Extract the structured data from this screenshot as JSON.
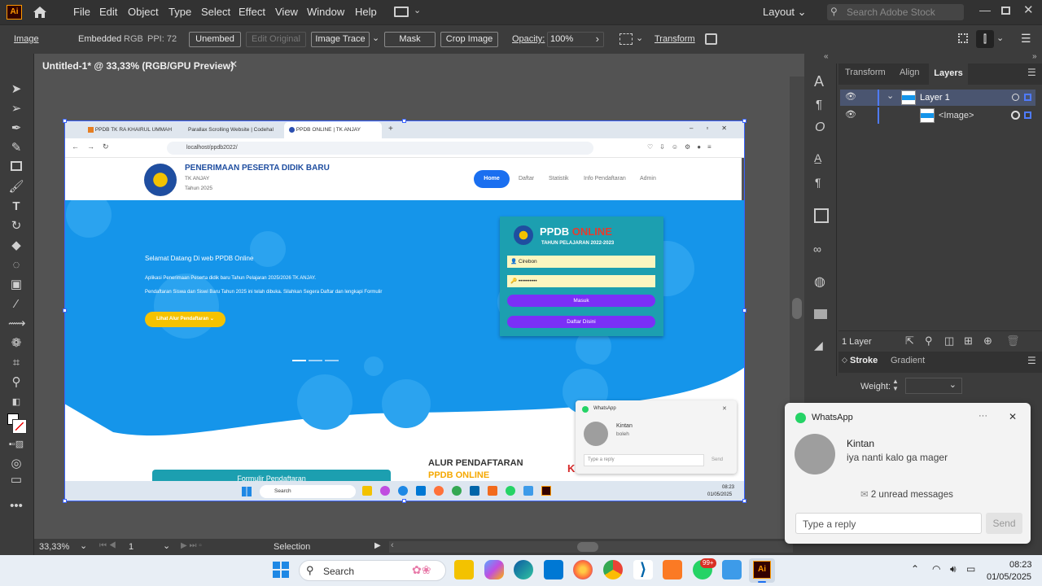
{
  "app": {
    "logo": "Ai",
    "menu": [
      "File",
      "Edit",
      "Object",
      "Type",
      "Select",
      "Effect",
      "View",
      "Window",
      "Help"
    ],
    "workspace": "Layout",
    "search_placeholder": "Search Adobe Stock"
  },
  "control_bar": {
    "object_type": "Image",
    "embedded": "Embedded",
    "color_mode": "RGB",
    "ppi": "PPI: 72",
    "unembed": "Unembed",
    "edit_original": "Edit Original",
    "image_trace": "Image Trace",
    "mask": "Mask",
    "crop_image": "Crop Image",
    "opacity_label": "Opacity:",
    "opacity_value": "100%",
    "transform": "Transform"
  },
  "document": {
    "tab_title": "Untitled-1* @ 33,33% (RGB/GPU Preview)",
    "zoom": "33,33%",
    "artboard_num": "1",
    "status_tool": "Selection"
  },
  "layers_panel": {
    "tabs": [
      "Transform",
      "Align",
      "Layers"
    ],
    "layer_name": "Layer 1",
    "sublayer_name": "<Image>",
    "count": "1 Layer"
  },
  "stroke_panel": {
    "tabs": [
      "Stroke",
      "Gradient"
    ],
    "weight_label": "Weight:"
  },
  "embedded_browser": {
    "tabs": [
      "PPDB TK RA KHAIRUL UMMAH",
      "Parallax Scrolling Website | Codehal",
      "PPDB ONLINE | TK ANJAY"
    ],
    "url": "localhost/ppdb2022/",
    "site_title": "PENERIMAAN PESERTA DIDIK BARU",
    "site_sub1": "TK ANJAY",
    "site_sub2": "Tahun 2025",
    "nav": [
      "Home",
      "Daftar",
      "Statistik",
      "Info Pendaftaran",
      "Admin"
    ],
    "welcome": "Selamat Datang Di web PPDB Online",
    "desc1": "Aplikasi Penerimaan Peserta didik baru Tahun Pelajaran 2025/2026 TK ANJAY.",
    "desc2": "Pendaftaran Siswa dan Siswi Baru Tahun 2025 ini telah dibuka. Silahkan Segera Daftar dan lengkapi Formulir",
    "cta": "Lihat Alur Pendaftaran",
    "login_title1": "PPDB",
    "login_title2": "ONLINE",
    "login_sub": "TAHUN PELAJARAN 2022-2023",
    "username": "Cirebon",
    "password": "••••••••••",
    "masuk": "Masuk",
    "daftar": "Daftar Disini",
    "alur1": "ALUR PENDAFTARAN",
    "alur2": "PPDB ONLINE",
    "form_btn": "Formulir Pendaftaran",
    "wa_app": "WhatsApp",
    "wa_name": "Kintan",
    "wa_msg": "boleh",
    "wa_reply": "Type a reply",
    "wa_send": "Send",
    "task_search": "Search",
    "task_time": "08:23",
    "task_date": "01/05/2025"
  },
  "notification": {
    "app": "WhatsApp",
    "sender": "Kintan",
    "message": "iya nanti kalo ga mager",
    "unread": "2 unread messages",
    "reply_placeholder": "Type a reply",
    "send": "Send"
  },
  "taskbar": {
    "search": "Search",
    "time": "08:23",
    "date": "01/05/2025",
    "whatsapp_badge": "99+"
  },
  "colors": {
    "accent": "#2f7bf6",
    "site_blue": "#1595ea",
    "cta_yellow": "#f5c200",
    "login_teal": "#1c9fb0",
    "purple": "#7b2ff7"
  }
}
